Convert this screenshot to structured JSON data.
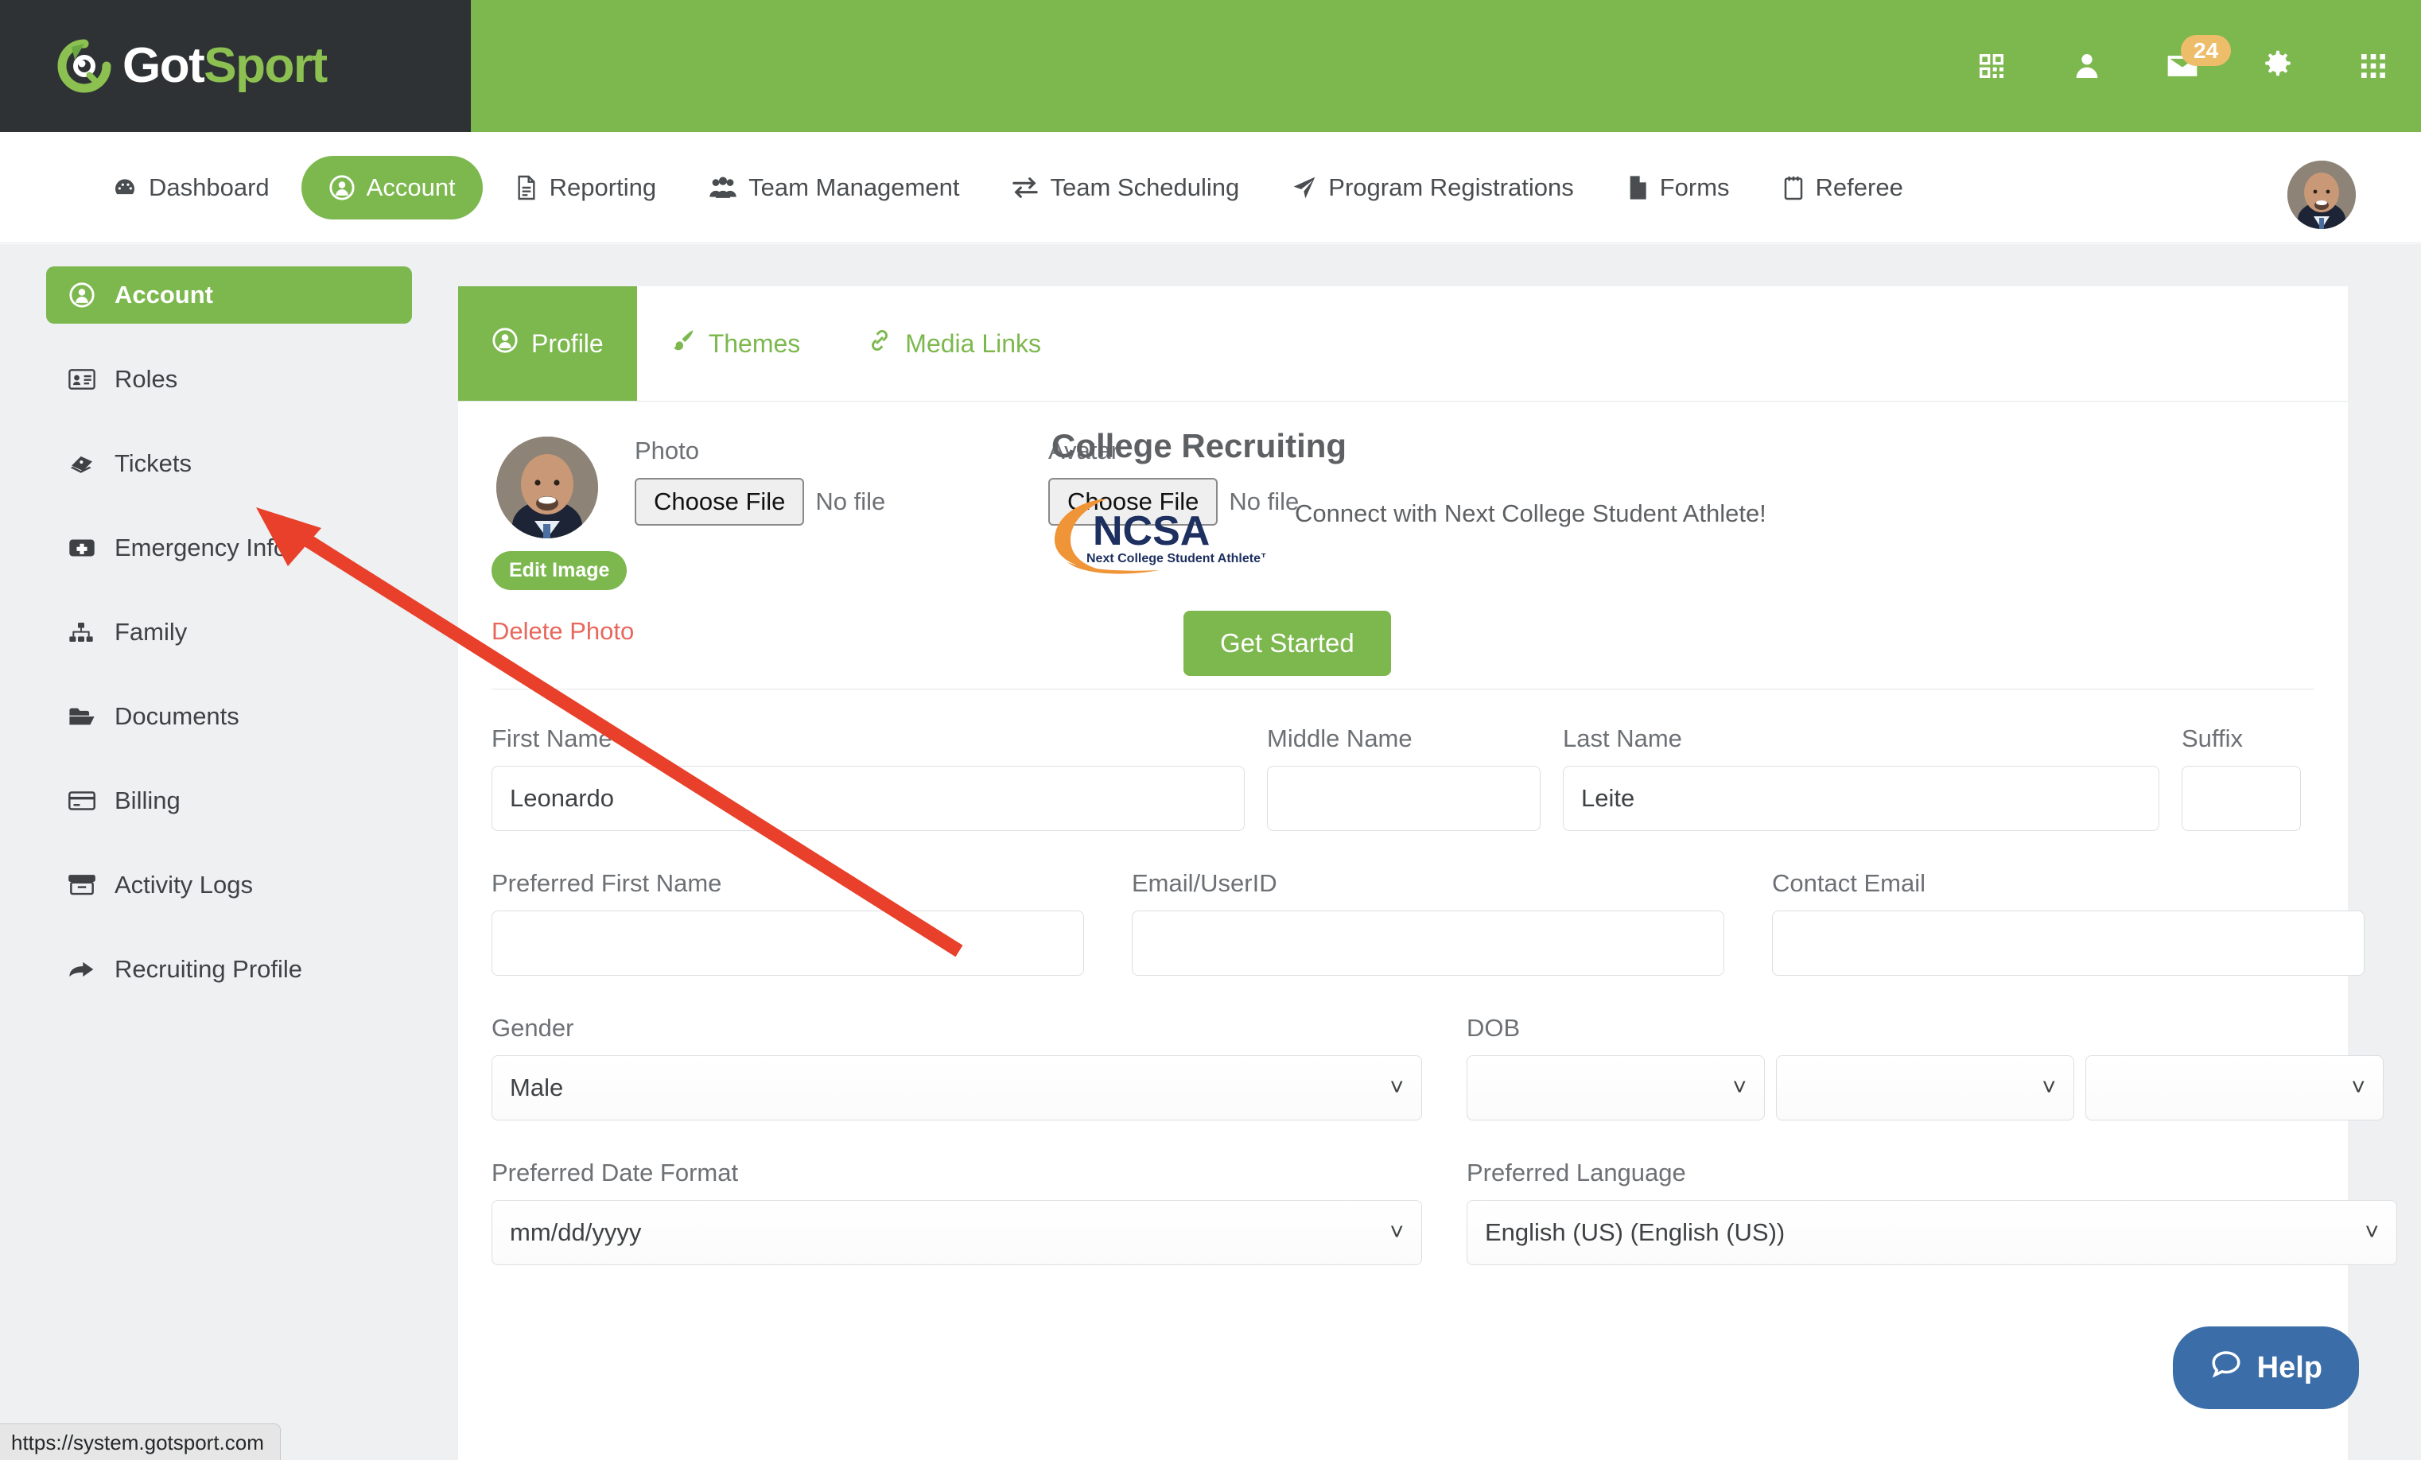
{
  "brand": {
    "name_first": "Got",
    "name_second": "Sport"
  },
  "topbar": {
    "icons": [
      {
        "name": "qr-code-icon",
        "label": "QR Code"
      },
      {
        "name": "user-icon",
        "label": "User"
      },
      {
        "name": "mail-icon",
        "label": "Messages"
      },
      {
        "name": "gear-icon",
        "label": "Settings"
      },
      {
        "name": "grid-apps-icon",
        "label": "Apps"
      }
    ],
    "mail_badge": "24"
  },
  "nav": {
    "items": [
      {
        "label": "Dashboard",
        "icon": "dashboard-icon",
        "active": false
      },
      {
        "label": "Account",
        "icon": "user-circle-icon",
        "active": true
      },
      {
        "label": "Reporting",
        "icon": "document-icon",
        "active": false
      },
      {
        "label": "Team Management",
        "icon": "users-icon",
        "active": false
      },
      {
        "label": "Team Scheduling",
        "icon": "exchange-icon",
        "active": false
      },
      {
        "label": "Program Registrations",
        "icon": "paper-plane-icon",
        "active": false
      },
      {
        "label": "Forms",
        "icon": "file-icon",
        "active": false
      },
      {
        "label": "Referee",
        "icon": "clipboard-icon",
        "active": false
      }
    ]
  },
  "sidebar": {
    "items": [
      {
        "label": "Account",
        "icon": "user-circle-icon",
        "active": true
      },
      {
        "label": "Roles",
        "icon": "id-card-icon",
        "active": false
      },
      {
        "label": "Tickets",
        "icon": "ticket-icon",
        "active": false
      },
      {
        "label": "Emergency Info",
        "icon": "first-aid-icon",
        "active": false
      },
      {
        "label": "Family",
        "icon": "sitemap-icon",
        "active": false
      },
      {
        "label": "Documents",
        "icon": "folder-open-icon",
        "active": false
      },
      {
        "label": "Billing",
        "icon": "credit-card-icon",
        "active": false
      },
      {
        "label": "Activity Logs",
        "icon": "archive-icon",
        "active": false
      },
      {
        "label": "Recruiting Profile",
        "icon": "share-arrow-icon",
        "active": false
      }
    ]
  },
  "tabs": [
    {
      "label": "Profile",
      "icon": "user-circle-icon",
      "active": true
    },
    {
      "label": "Themes",
      "icon": "paint-brush-icon",
      "active": false
    },
    {
      "label": "Media Links",
      "icon": "link-icon",
      "active": false
    }
  ],
  "photo_section": {
    "photo_label": "Photo",
    "photo_button": "Choose File",
    "photo_filename": "No file",
    "avatar_label": "Avatar",
    "avatar_button": "Choose File",
    "avatar_filename": "No file",
    "edit_image": "Edit Image",
    "delete_photo": "Delete Photo"
  },
  "recruiting": {
    "title": "College Recruiting",
    "logo_name": "NCSA",
    "logo_tagline": "Next College Student Athlete™",
    "description": "Connect with Next College Student Athlete!",
    "cta": "Get Started"
  },
  "form": {
    "first_name": {
      "label": "First Name",
      "value": "Leonardo"
    },
    "middle_name": {
      "label": "Middle Name",
      "value": ""
    },
    "last_name": {
      "label": "Last Name",
      "value": "Leite"
    },
    "suffix": {
      "label": "Suffix",
      "value": ""
    },
    "preferred_first_name": {
      "label": "Preferred First Name",
      "value": ""
    },
    "email_userid": {
      "label": "Email/UserID",
      "value": ""
    },
    "contact_email": {
      "label": "Contact Email",
      "value": ""
    },
    "gender": {
      "label": "Gender",
      "value": "Male"
    },
    "dob": {
      "label": "DOB",
      "month": "",
      "day": "",
      "year": ""
    },
    "preferred_date_format": {
      "label": "Preferred Date Format",
      "value": "mm/dd/yyyy"
    },
    "preferred_language": {
      "label": "Preferred Language",
      "value": "English (US) (English (US))"
    }
  },
  "help_widget": {
    "label": "Help",
    "icon": "chat-bubble-icon"
  },
  "status_bar": {
    "url": "https://system.gotsport.com"
  },
  "colors": {
    "brand_green": "#7cb84e",
    "brand_dark": "#2f3234",
    "badge_amber": "#edbd6a",
    "danger_red": "#e8675c",
    "annotation_red": "#e8402a",
    "help_blue": "#3b6ea8"
  }
}
